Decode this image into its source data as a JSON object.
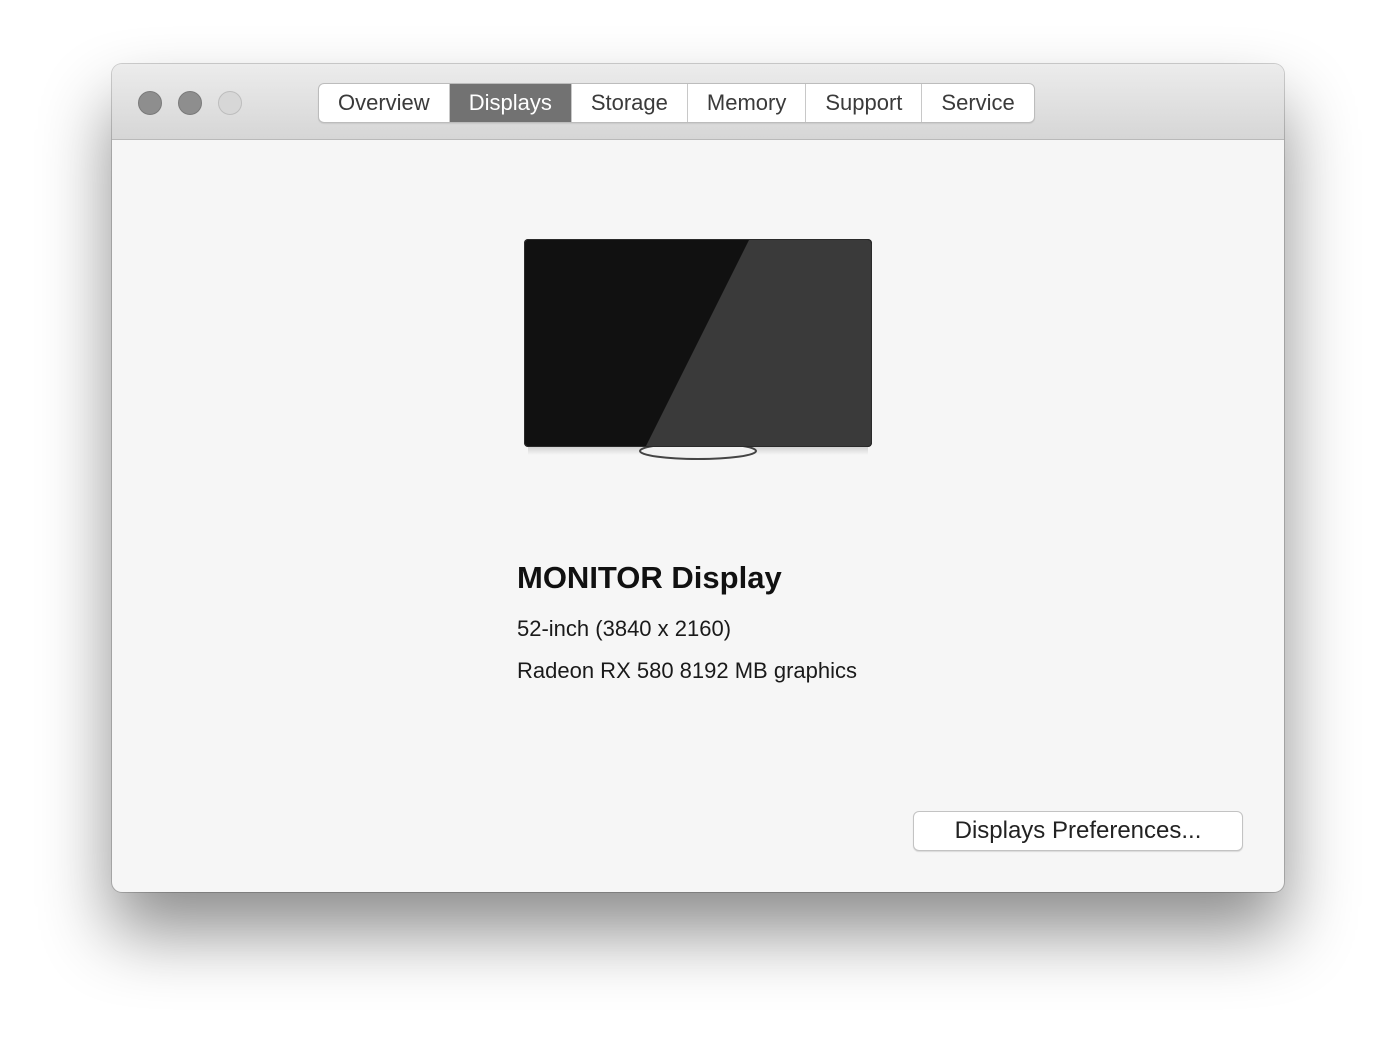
{
  "tabs": [
    {
      "label": "Overview",
      "active": false
    },
    {
      "label": "Displays",
      "active": true
    },
    {
      "label": "Storage",
      "active": false
    },
    {
      "label": "Memory",
      "active": false
    },
    {
      "label": "Support",
      "active": false
    },
    {
      "label": "Service",
      "active": false
    }
  ],
  "display": {
    "icon": "monitor-icon",
    "name": "MONITOR Display",
    "size": "52-inch (3840 x 2160)",
    "graphics": "Radeon RX 580 8192 MB graphics"
  },
  "buttons": {
    "preferences_label": "Displays Preferences..."
  },
  "colors": {
    "active_tab": "#727272",
    "window_bg": "#f6f6f6"
  }
}
